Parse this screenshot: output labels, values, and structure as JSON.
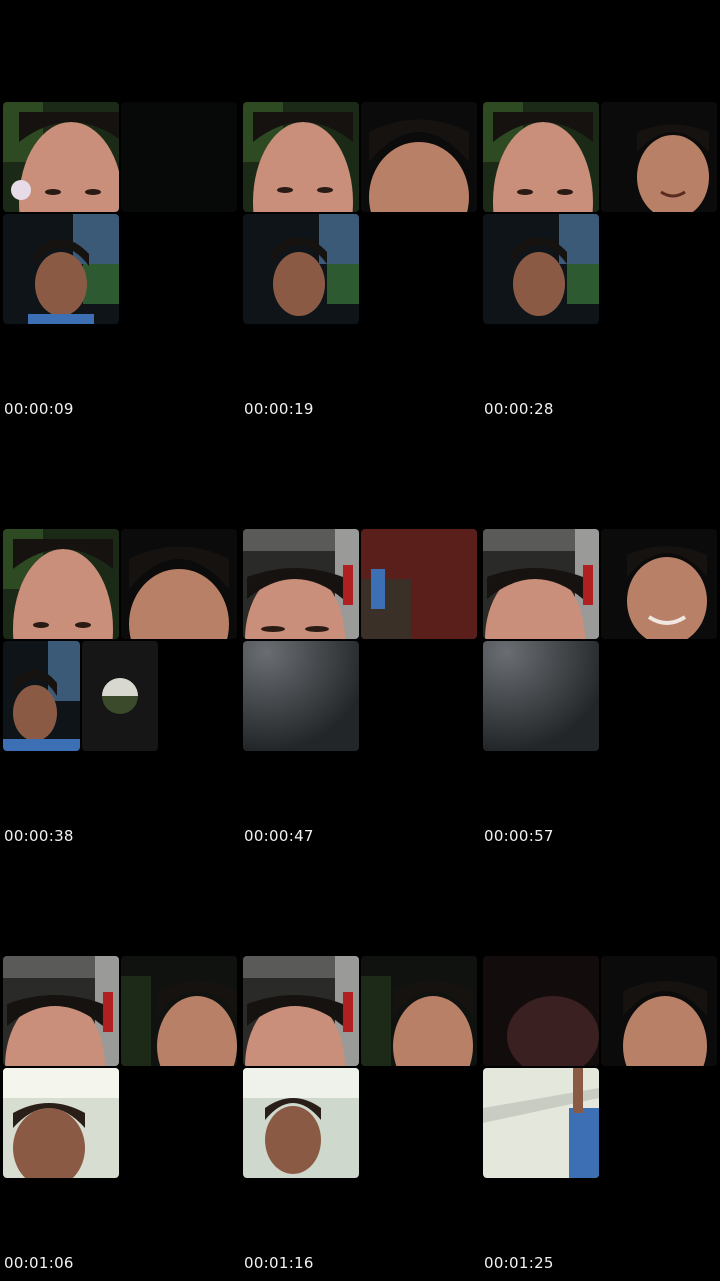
{
  "timestamps": [
    "00:00:09",
    "00:00:19",
    "00:00:28",
    "00:00:38",
    "00:00:47",
    "00:00:57",
    "00:01:06",
    "00:01:16",
    "00:01:25"
  ],
  "tile_colors": {
    "night": "#111410",
    "skin": "#c98f7a",
    "hair": "#161210",
    "shirt_blue": "#3d6fb5",
    "plant_green": "#2d4a23",
    "grey_screen": "#2b2f33",
    "bright_room": "#d7ddd0",
    "red_wall": "#5a1f1a"
  }
}
